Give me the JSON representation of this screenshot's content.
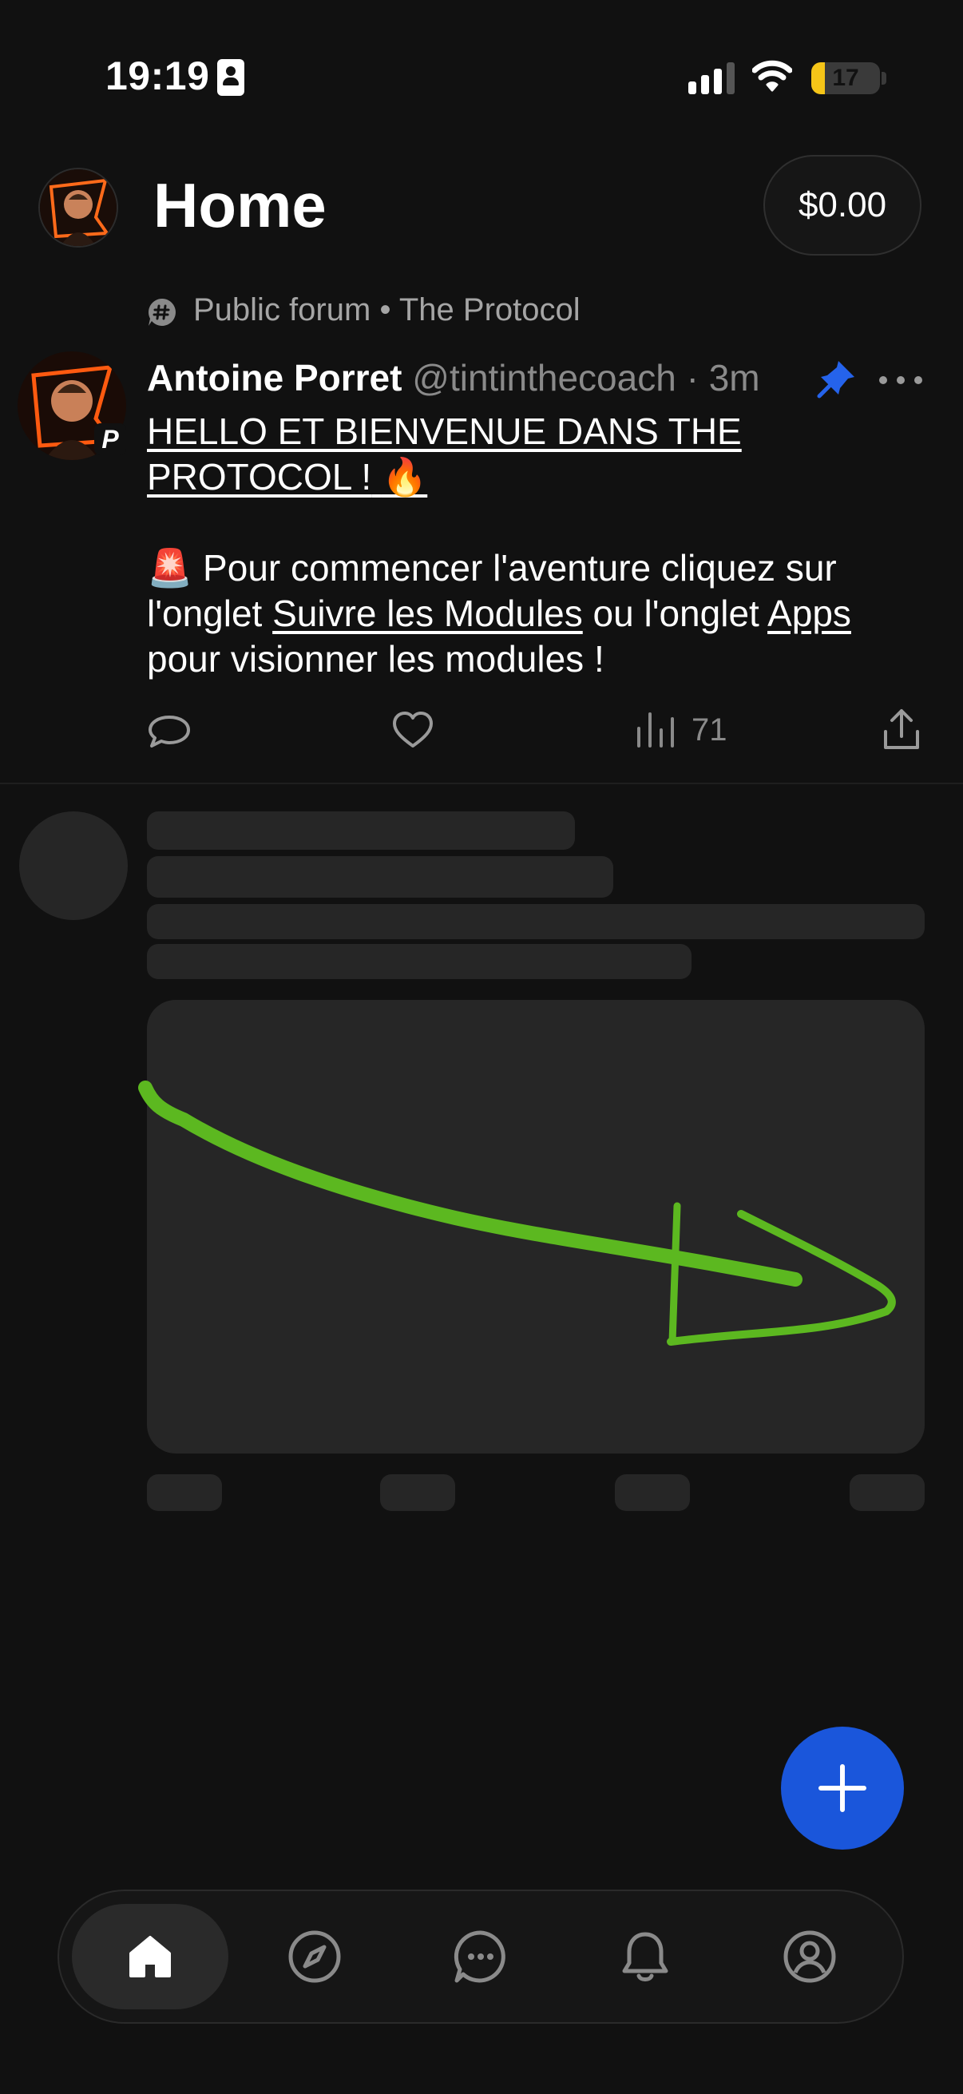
{
  "status_bar": {
    "time": "19:19",
    "battery": "17"
  },
  "header": {
    "title": "Home",
    "balance": "$0.00"
  },
  "forum": {
    "label": "Public forum",
    "separator": "•",
    "community": "The Protocol"
  },
  "post": {
    "author": "Antoine Porret",
    "handle": "@tintinthecoach",
    "time": "· 3m",
    "badge": "P",
    "headline_line1": "HELLO ET BIENVENUE DANS THE",
    "headline_line2": "PROTOCOL !",
    "headline_emoji": "🔥",
    "body_siren": "🚨",
    "body_part1": " Pour commencer l'aventure cliquez sur l'onglet ",
    "body_link1": "Suivre les Modules",
    "body_part2": " ou l'onglet ",
    "body_link2": "Apps",
    "body_part3": " pour visionner les modules !",
    "views": "71"
  },
  "icons": {
    "forum": "forum-hash-icon",
    "pin": "pin-icon",
    "more": "more-icon",
    "reply": "reply-icon",
    "like": "heart-icon",
    "views": "views-icon",
    "share": "share-icon",
    "compose": "plus-icon",
    "tabs": [
      "home-icon",
      "explore-icon",
      "messages-icon",
      "notifications-icon",
      "profile-icon"
    ]
  },
  "colors": {
    "accent": "#1a56db",
    "pin": "#2563eb",
    "annotation_arrow": "#5cb820",
    "battery": "#f5c518"
  }
}
